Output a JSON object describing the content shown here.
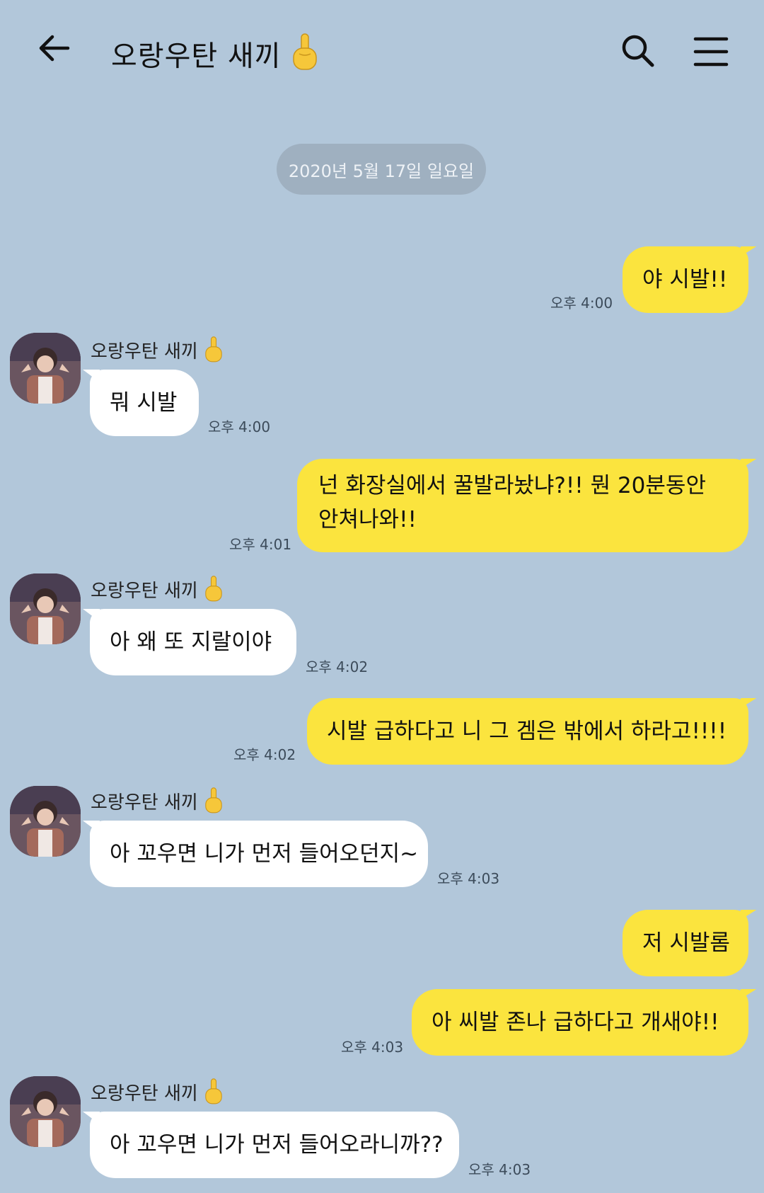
{
  "header": {
    "title": "오랑우탄 새끼",
    "title_emoji": "middle-finger-emoji"
  },
  "date_divider": "2020년 5월 17일 일요일",
  "sender_name": "오랑우탄 새끼",
  "messages": [
    {
      "from": "me",
      "text": "야 시발!!",
      "time": "오후 4:00"
    },
    {
      "from": "other",
      "text": "뭐 시발",
      "time": "오후 4:00"
    },
    {
      "from": "me",
      "line1": "넌 화장실에서 꿀발라놨냐?!! 뭔 20분동안",
      "line2": "안쳐나와!!",
      "time": "오후 4:01"
    },
    {
      "from": "other",
      "text": "아 왜 또 지랄이야",
      "time": "오후 4:02"
    },
    {
      "from": "me",
      "text": "시발 급하다고 니 그 겜은 밖에서 하라고!!!!",
      "time": "오후 4:02"
    },
    {
      "from": "other",
      "text": "아 꼬우면 니가 먼저 들어오던지~",
      "time": "오후 4:03"
    },
    {
      "from": "me",
      "text": "저 시발롬"
    },
    {
      "from": "me",
      "text": "아 씨발 존나 급하다고 개새야!!",
      "time": "오후 4:03"
    },
    {
      "from": "other",
      "text": "아 꼬우면 니가 먼저 들어오라니까??",
      "time": "오후 4:03"
    }
  ],
  "colors": {
    "background": "#b2c7da",
    "my_bubble": "#fbe43e",
    "other_bubble": "#ffffff",
    "date_pill": "#9fb0c0"
  }
}
